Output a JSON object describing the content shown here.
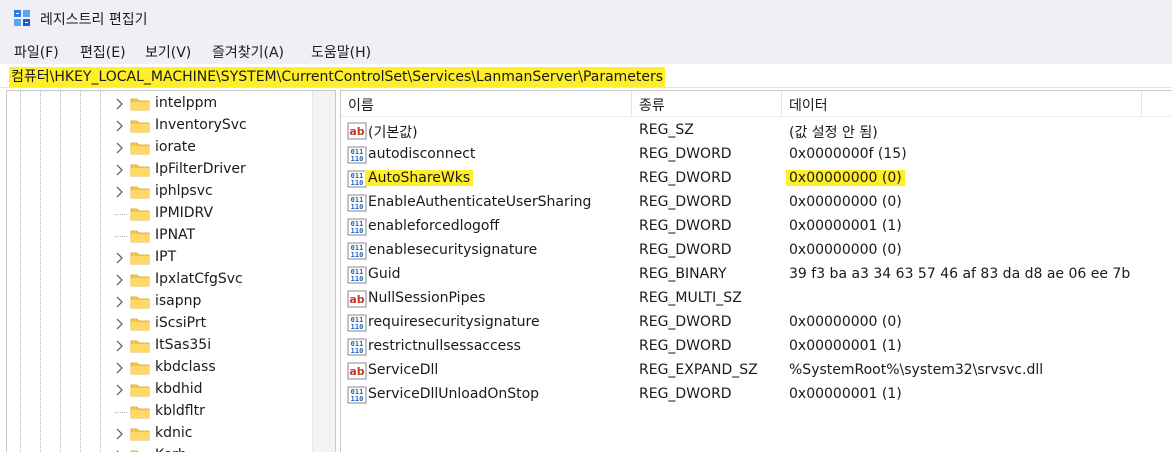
{
  "window": {
    "title": "레지스트리 편집기"
  },
  "menu": [
    {
      "label": "파일(F)"
    },
    {
      "label": "편집(E)"
    },
    {
      "label": "보기(V)"
    },
    {
      "label": "즐겨찾기(A)"
    },
    {
      "label": "도움말(H)"
    }
  ],
  "address": {
    "path": "컴퓨터\\HKEY_LOCAL_MACHINE\\SYSTEM\\CurrentControlSet\\Services\\LanmanServer\\Parameters"
  },
  "tree": {
    "items": [
      {
        "label": "intelppm",
        "expandable": true
      },
      {
        "label": "InventorySvc",
        "expandable": true
      },
      {
        "label": "iorate",
        "expandable": true
      },
      {
        "label": "IpFilterDriver",
        "expandable": true
      },
      {
        "label": "iphlpsvc",
        "expandable": true
      },
      {
        "label": "IPMIDRV",
        "expandable": false
      },
      {
        "label": "IPNAT",
        "expandable": false
      },
      {
        "label": "IPT",
        "expandable": true
      },
      {
        "label": "IpxlatCfgSvc",
        "expandable": true
      },
      {
        "label": "isapnp",
        "expandable": true
      },
      {
        "label": "iScsiPrt",
        "expandable": true
      },
      {
        "label": "ItSas35i",
        "expandable": true
      },
      {
        "label": "kbdclass",
        "expandable": true
      },
      {
        "label": "kbdhid",
        "expandable": true
      },
      {
        "label": "kbldfltr",
        "expandable": false
      },
      {
        "label": "kdnic",
        "expandable": true
      },
      {
        "label": "Kerb",
        "expandable": true
      }
    ]
  },
  "list": {
    "columns": {
      "name": "이름",
      "type": "종류",
      "data": "데이터"
    },
    "rows": [
      {
        "icon": "string-value-icon",
        "name": "(기본값)",
        "type": "REG_SZ",
        "data": "(값 설정 안 됨)",
        "highlight": false
      },
      {
        "icon": "binary-value-icon",
        "name": "autodisconnect",
        "type": "REG_DWORD",
        "data": "0x0000000f (15)",
        "highlight": false
      },
      {
        "icon": "binary-value-icon",
        "name": "AutoShareWks",
        "type": "REG_DWORD",
        "data": "0x00000000 (0)",
        "highlight": true
      },
      {
        "icon": "binary-value-icon",
        "name": "EnableAuthenticateUserSharing",
        "type": "REG_DWORD",
        "data": "0x00000000 (0)",
        "highlight": false
      },
      {
        "icon": "binary-value-icon",
        "name": "enableforcedlogoff",
        "type": "REG_DWORD",
        "data": "0x00000001 (1)",
        "highlight": false
      },
      {
        "icon": "binary-value-icon",
        "name": "enablesecuritysignature",
        "type": "REG_DWORD",
        "data": "0x00000000 (0)",
        "highlight": false
      },
      {
        "icon": "binary-value-icon",
        "name": "Guid",
        "type": "REG_BINARY",
        "data": "39 f3 ba a3 34 63 57 46 af 83 da d8 ae 06 ee 7b",
        "highlight": false
      },
      {
        "icon": "string-value-icon",
        "name": "NullSessionPipes",
        "type": "REG_MULTI_SZ",
        "data": "",
        "highlight": false
      },
      {
        "icon": "binary-value-icon",
        "name": "requiresecuritysignature",
        "type": "REG_DWORD",
        "data": "0x00000000 (0)",
        "highlight": false
      },
      {
        "icon": "binary-value-icon",
        "name": "restrictnullsessaccess",
        "type": "REG_DWORD",
        "data": "0x00000001 (1)",
        "highlight": false
      },
      {
        "icon": "string-value-icon",
        "name": "ServiceDll",
        "type": "REG_EXPAND_SZ",
        "data": "%SystemRoot%\\system32\\srvsvc.dll",
        "highlight": false
      },
      {
        "icon": "binary-value-icon",
        "name": "ServiceDllUnloadOnStop",
        "type": "REG_DWORD",
        "data": "0x00000001 (1)",
        "highlight": false
      }
    ]
  },
  "colors": {
    "highlight": "#ffef2a",
    "folder": "#f6c644",
    "chrome": "#eef0f6"
  }
}
